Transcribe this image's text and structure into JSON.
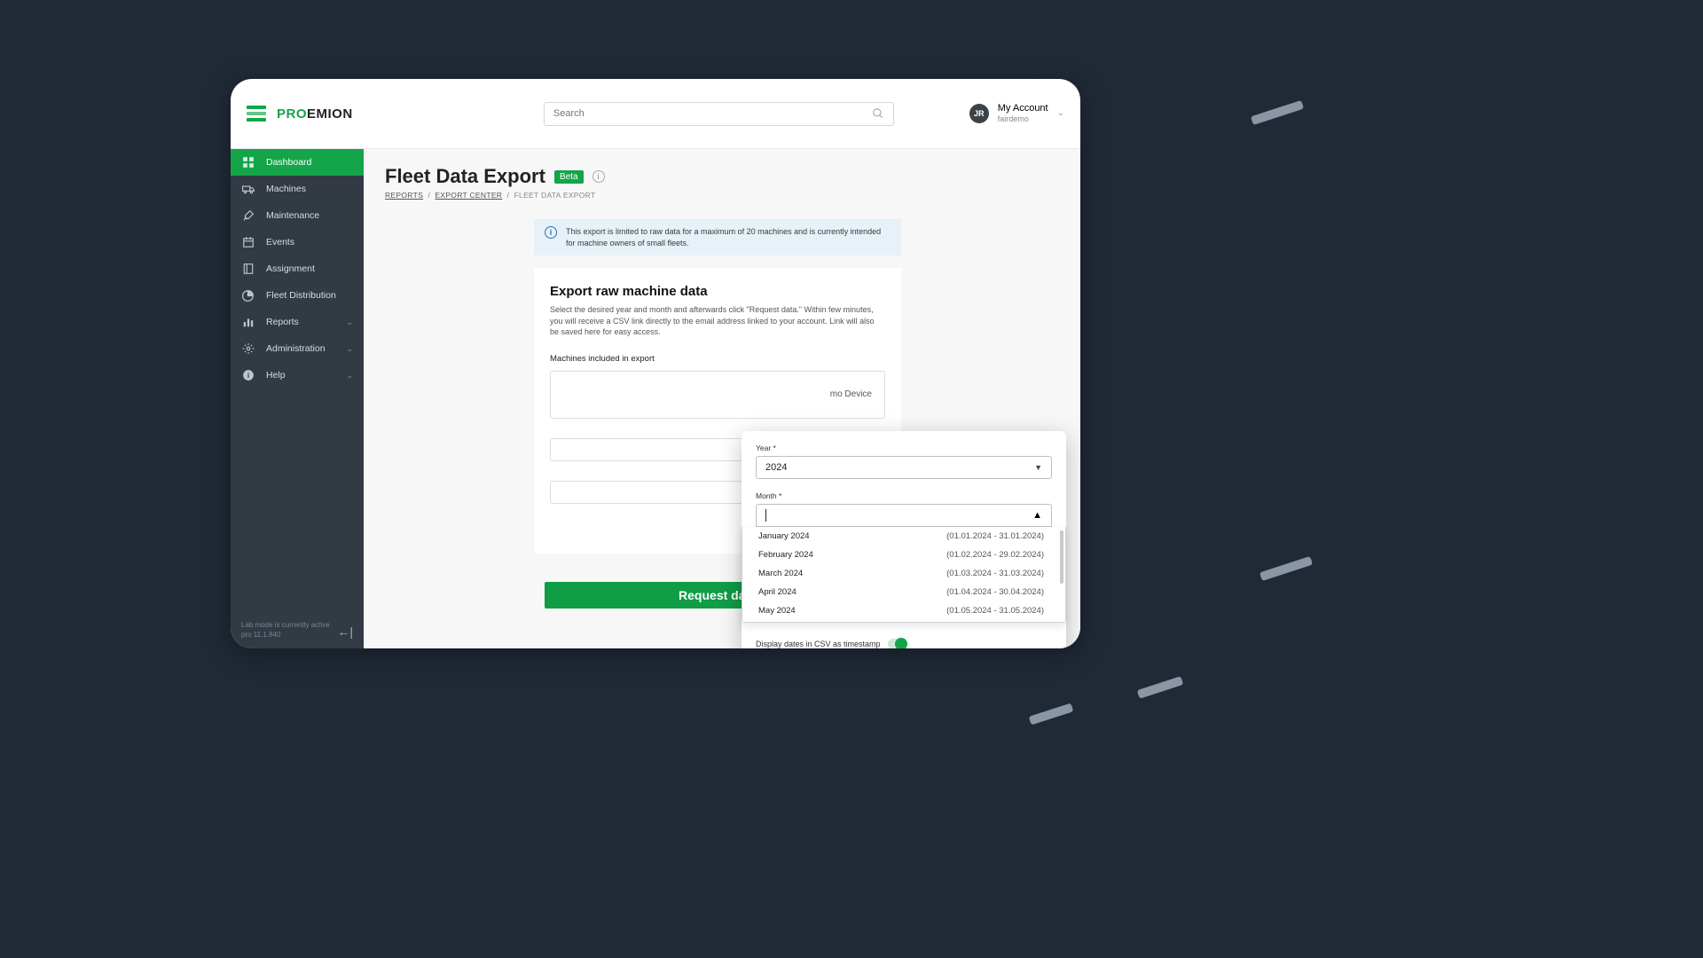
{
  "header": {
    "brand_pro": "PRO",
    "brand_emion": "EMION",
    "search_placeholder": "Search",
    "avatar_initials": "JR",
    "account_title": "My Account",
    "account_sub": "fairdemo"
  },
  "sidebar": {
    "items": [
      {
        "label": "Dashboard",
        "icon": "grid-icon",
        "active": true
      },
      {
        "label": "Machines",
        "icon": "truck-icon"
      },
      {
        "label": "Maintenance",
        "icon": "tools-icon"
      },
      {
        "label": "Events",
        "icon": "calendar-icon"
      },
      {
        "label": "Assignment",
        "icon": "book-icon"
      },
      {
        "label": "Fleet Distribution",
        "icon": "pie-icon"
      },
      {
        "label": "Reports",
        "icon": "bars-icon",
        "expandable": true
      },
      {
        "label": "Administration",
        "icon": "gear-icon",
        "expandable": true
      },
      {
        "label": "Help",
        "icon": "info-icon",
        "expandable": true
      }
    ],
    "footer_line1": "Lab mode is currently active",
    "footer_line2": "pro 11.1.840"
  },
  "page": {
    "title": "Fleet Data Export",
    "badge": "Beta",
    "breadcrumbs": {
      "a": "REPORTS",
      "b": "EXPORT CENTER",
      "c": "FLEET DATA EXPORT",
      "sep": "/"
    },
    "info_banner": "This export is limited to raw data for a maximum of 20 machines and is currently intended for machine owners of small fleets.",
    "card": {
      "heading": "Export raw machine data",
      "description": "Select the desired year and month and afterwards click \"Request data.\" Within few minutes, you will receive a CSV link directly to the email address linked to your account. Link will also be saved here for easy access.",
      "machines_label": "Machines included in export",
      "machines_hint": "mo Device"
    },
    "toggle_label": "Display dates in CSV as timestamp",
    "request_button": "Request data"
  },
  "popup": {
    "year_label": "Year *",
    "year_value": "2024",
    "month_label": "Month *",
    "options": [
      {
        "label": "January 2024",
        "range": "(01.01.2024 - 31.01.2024)"
      },
      {
        "label": "February 2024",
        "range": "(01.02.2024 - 29.02.2024)"
      },
      {
        "label": "March 2024",
        "range": "(01.03.2024 - 31.03.2024)"
      },
      {
        "label": "April 2024",
        "range": "(01.04.2024 - 30.04.2024)"
      },
      {
        "label": "May 2024",
        "range": "(01.05.2024 - 31.05.2024)"
      }
    ],
    "toggle_label": "Display dates in CSV as timestamp"
  }
}
